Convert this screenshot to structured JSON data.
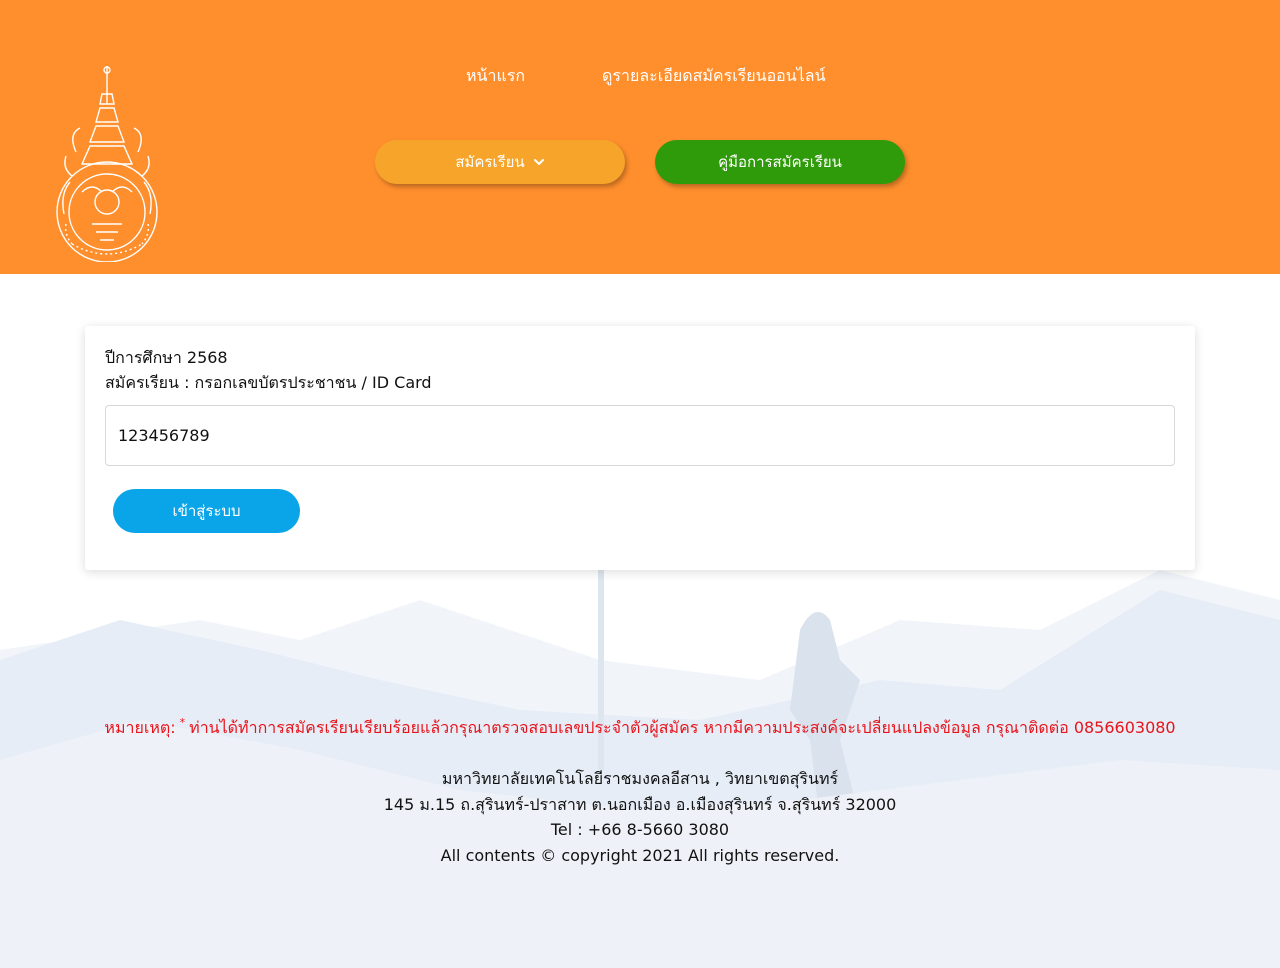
{
  "header": {
    "logo": "university-seal",
    "nav": {
      "home": "หน้าแรก",
      "details": "ดูรายละเอียดสมัครเรียนออนไลน์"
    },
    "apply_button": "สมัครเรียน",
    "guide_button": "คู่มือการสมัครเรียน",
    "colors": {
      "header_bg": "#ff8f2d",
      "apply_bg": "#f6a52a",
      "guide_bg": "#2f9b0a"
    }
  },
  "form": {
    "academic_year": "ปีการศึกษา 2568",
    "prompt": "สมัครเรียน : กรอกเลขบัตรประชาชน / ID Card",
    "id_value": "123456789",
    "submit_label": "เข้าสู่ระบบ",
    "submit_color": "#0aa5e8"
  },
  "notice": {
    "label": "หมายเหตุ:",
    "star": "*",
    "text": "ท่านได้ทำการสมัครเรียนเรียบร้อยแล้วกรุณาตรวจสอบเลขประจำตัวผู้สมัคร หากมีความประสงค์จะเปลี่ยนแปลงข้อมูล กรุณาติดต่อ 0856603080",
    "color": "#e8141b"
  },
  "footer": {
    "name": "มหาวิทยาลัยเทคโนโลยีราชมงคลอีสาน , วิทยาเขตสุรินทร์",
    "address": "145 ม.15 ถ.สุรินทร์-ปราสาท ต.นอกเมือง อ.เมืองสุรินทร์ จ.สุรินทร์ 32000",
    "tel": "Tel : +66 8-5660 3080",
    "copyright": "All contents © copyright 2021 All rights reserved."
  }
}
